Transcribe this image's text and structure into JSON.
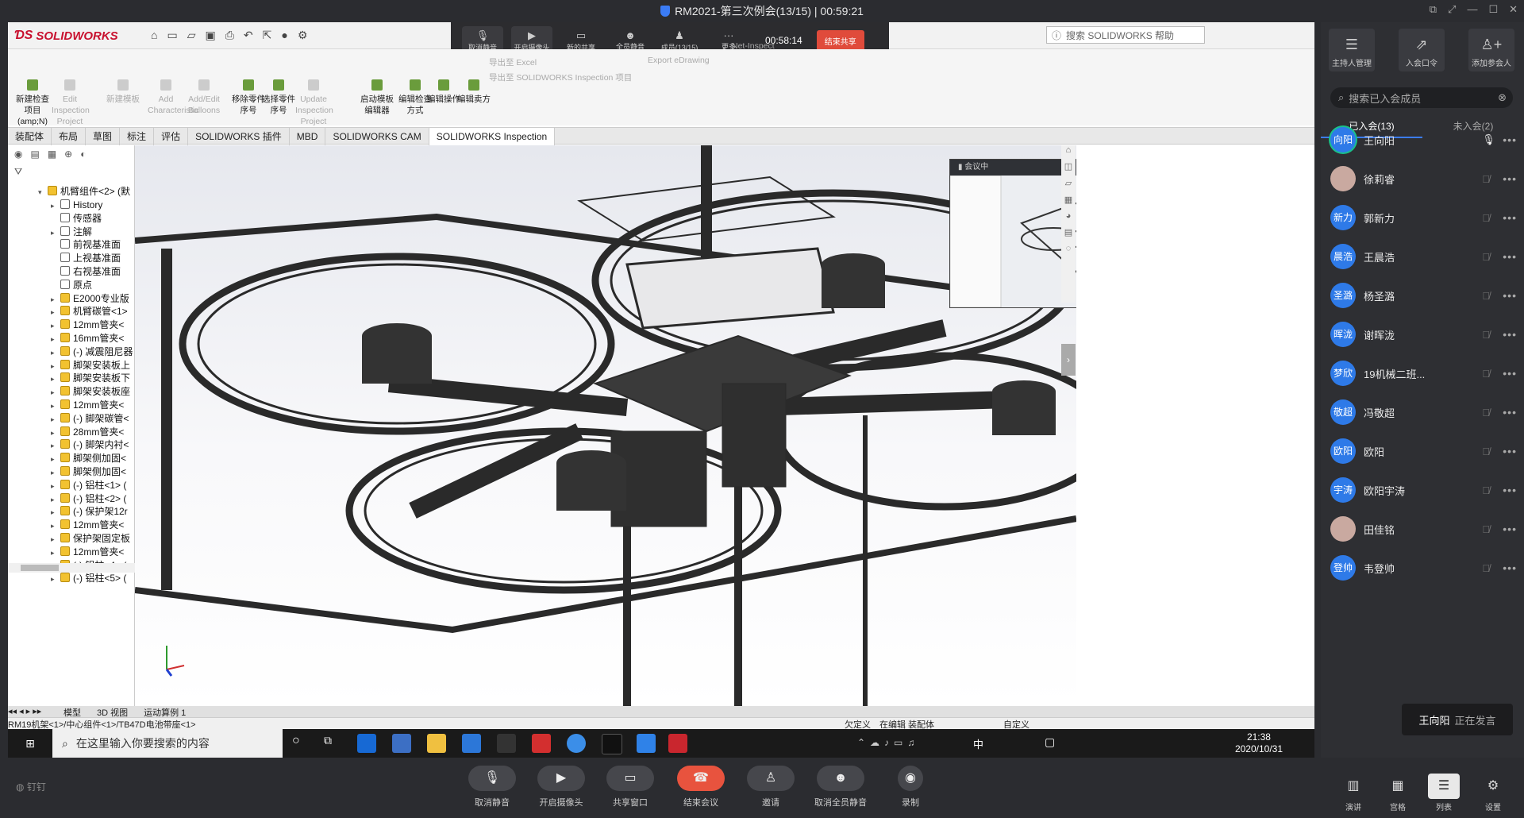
{
  "window": {
    "title": "RM2021-第三次例会(13/15) | 00:59:21"
  },
  "solidworks": {
    "logo": "SOLIDWORKS",
    "search_placeholder": "搜索 SOLIDWORKS 帮助",
    "ribbon": [
      {
        "label": "新建检查项目(amp;N)",
        "enabled": true
      },
      {
        "label": "Edit Inspection Project",
        "enabled": false
      },
      {
        "label": "新建模板",
        "enabled": false
      },
      {
        "label": "Add Characteristic",
        "enabled": false
      },
      {
        "label": "Add/Edit Balloons",
        "enabled": false
      },
      {
        "label": "移除零件序号",
        "enabled": true
      },
      {
        "label": "选择零件序号",
        "enabled": true
      },
      {
        "label": "Update Inspection Project",
        "enabled": false
      },
      {
        "label": "启动模板编辑器",
        "enabled": true
      },
      {
        "label": "编辑检查方式",
        "enabled": true
      },
      {
        "label": "编辑操作",
        "enabled": true
      },
      {
        "label": "编辑卖方",
        "enabled": true
      }
    ],
    "ribbon_right": [
      "导出至 Excel",
      "Export eDrawing",
      "导出至 SOLIDWORKS Inspection 项目",
      "Net-Inspect"
    ],
    "tabs": [
      "装配体",
      "布局",
      "草图",
      "标注",
      "评估",
      "SOLIDWORKS 插件",
      "MBD",
      "SOLIDWORKS CAM",
      "SOLIDWORKS Inspection"
    ],
    "active_tab": "SOLIDWORKS Inspection",
    "tree_root": "机臂组件<2> (默",
    "tree": [
      {
        "label": "History",
        "kind": "folder",
        "arrow": "▸"
      },
      {
        "label": "传感器",
        "kind": "folder",
        "arrow": ""
      },
      {
        "label": "注解",
        "kind": "folder",
        "arrow": "▸"
      },
      {
        "label": "前视基准面",
        "kind": "plane",
        "arrow": ""
      },
      {
        "label": "上视基准面",
        "kind": "plane",
        "arrow": ""
      },
      {
        "label": "右视基准面",
        "kind": "plane",
        "arrow": ""
      },
      {
        "label": "原点",
        "kind": "origin",
        "arrow": ""
      },
      {
        "label": "E2000专业版",
        "kind": "part",
        "arrow": "▸"
      },
      {
        "label": "机臂碳管<1>",
        "kind": "part",
        "arrow": "▸"
      },
      {
        "label": "12mm管夹<",
        "kind": "part",
        "arrow": "▸"
      },
      {
        "label": "16mm管夹<",
        "kind": "part",
        "arrow": "▸"
      },
      {
        "label": "(-) 减震阻尼器",
        "kind": "part",
        "arrow": "▸"
      },
      {
        "label": "脚架安装板上",
        "kind": "part",
        "arrow": "▸"
      },
      {
        "label": "脚架安装板下",
        "kind": "part",
        "arrow": "▸"
      },
      {
        "label": "脚架安装板座",
        "kind": "part",
        "arrow": "▸"
      },
      {
        "label": "12mm管夹<",
        "kind": "part",
        "arrow": "▸"
      },
      {
        "label": "(-) 脚架碳管<",
        "kind": "part",
        "arrow": "▸"
      },
      {
        "label": "28mm管夹<",
        "kind": "part",
        "arrow": "▸"
      },
      {
        "label": "(-) 脚架内衬<",
        "kind": "part",
        "arrow": "▸"
      },
      {
        "label": "脚架侧加固<",
        "kind": "part",
        "arrow": "▸"
      },
      {
        "label": "脚架侧加固<",
        "kind": "part",
        "arrow": "▸"
      },
      {
        "label": "(-) 铝柱<1> (",
        "kind": "part",
        "arrow": "▸"
      },
      {
        "label": "(-) 铝柱<2> (",
        "kind": "part",
        "arrow": "▸"
      },
      {
        "label": "(-) 保护架12r",
        "kind": "part",
        "arrow": "▸"
      },
      {
        "label": "12mm管夹<",
        "kind": "part",
        "arrow": "▸"
      },
      {
        "label": "保护架固定板",
        "kind": "part",
        "arrow": "▸"
      },
      {
        "label": "12mm管夹<",
        "kind": "part",
        "arrow": "▸"
      },
      {
        "label": "(-) 铝柱<4> (",
        "kind": "part",
        "arrow": "▸"
      },
      {
        "label": "(-) 铝柱<5> (",
        "kind": "part",
        "arrow": "▸"
      }
    ],
    "bottom_tabs": [
      "模型",
      "3D 视图",
      "运动算例 1"
    ],
    "status_path": "RM19机架<1>/中心组件<1>/TB47D电池带座<1>",
    "status_right": [
      "欠定义",
      "在编辑 装配体",
      "自定义"
    ]
  },
  "meeting_bar": {
    "buttons": [
      "取消静音",
      "开启摄像头",
      "新的共享",
      "全员静音",
      "成员(13/15)",
      "更多"
    ],
    "elapsed": "00:58:14",
    "end_share_label": "结束共享"
  },
  "preview": {
    "header": "会议中"
  },
  "taskbar": {
    "search_placeholder": "在这里输入你要搜索的内容",
    "time": "21:38",
    "date": "2020/10/31",
    "ime": "中"
  },
  "right_panel": {
    "top_buttons": [
      "主持人管理",
      "入会口令",
      "添加参会人"
    ],
    "search_placeholder": "搜索已入会成员",
    "tabs": [
      "已入会(13)",
      "未入会(2)"
    ],
    "members": [
      {
        "avatar": "向阳",
        "name": "王向阳",
        "photo": false,
        "speaking": true
      },
      {
        "avatar": "",
        "name": "徐莉睿",
        "photo": true,
        "speaking": false
      },
      {
        "avatar": "新力",
        "name": "郭新力",
        "photo": false,
        "speaking": false
      },
      {
        "avatar": "晨浩",
        "name": "王晨浩",
        "photo": false,
        "speaking": false
      },
      {
        "avatar": "圣潞",
        "name": "杨圣潞",
        "photo": false,
        "speaking": false
      },
      {
        "avatar": "晖泷",
        "name": "谢晖泷",
        "photo": false,
        "speaking": false
      },
      {
        "avatar": "梦欣",
        "name": "19机械二班...",
        "photo": false,
        "speaking": false
      },
      {
        "avatar": "敬超",
        "name": "冯敬超",
        "photo": false,
        "speaking": false
      },
      {
        "avatar": "欧阳",
        "name": "欧阳",
        "photo": false,
        "speaking": false
      },
      {
        "avatar": "宇涛",
        "name": "欧阳宇涛",
        "photo": false,
        "speaking": false
      },
      {
        "avatar": "",
        "name": "田佳铭",
        "photo": true,
        "speaking": false
      },
      {
        "avatar": "登帅",
        "name": "韦登帅",
        "photo": false,
        "speaking": false
      }
    ],
    "speaking_name": "王向阳",
    "speaking_status": "正在发言"
  },
  "bottom_bar": {
    "pin_label": "钉钉",
    "controls": [
      "取消静音",
      "开启摄像头",
      "共享窗口",
      "结束会议",
      "邀请",
      "取消全员静音",
      "录制"
    ],
    "views": [
      "演讲",
      "宫格",
      "列表",
      "设置"
    ],
    "active_view": "列表"
  }
}
